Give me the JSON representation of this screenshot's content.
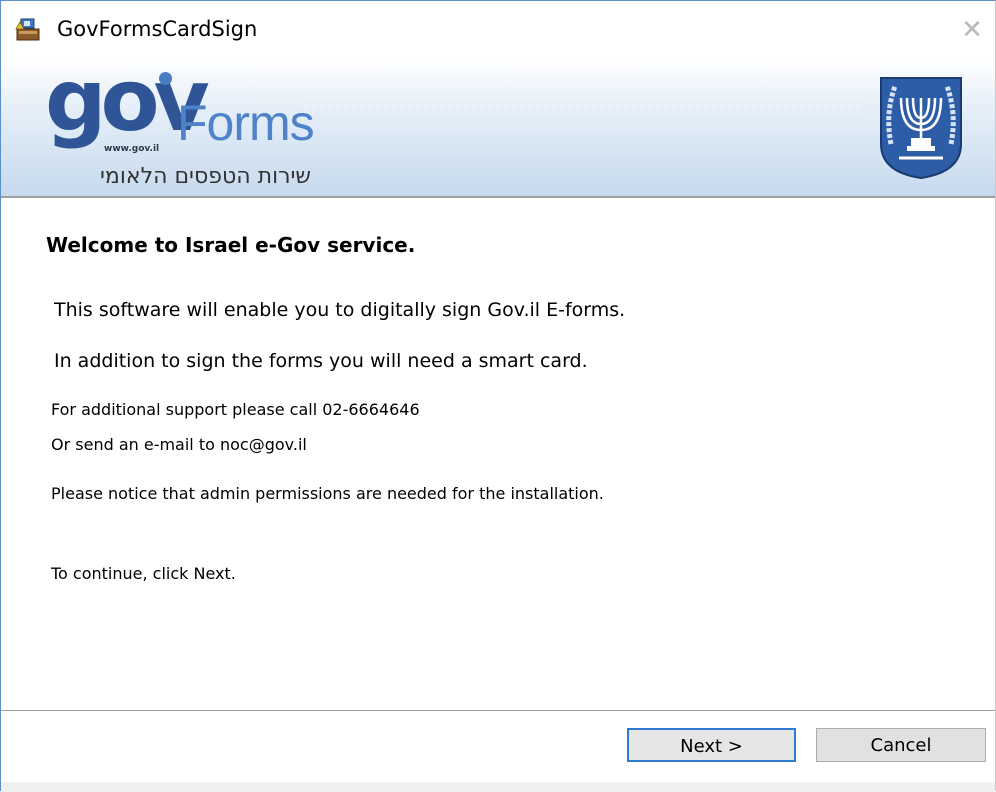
{
  "window": {
    "title": "GovFormsCardSign",
    "close_glyph": "✕"
  },
  "banner": {
    "logo_gov": "gov",
    "logo_forms": "Forms",
    "logo_url": "www.gov.il",
    "logo_hebrew": "שירות הטפסים הלאומי"
  },
  "content": {
    "welcome": "Welcome to Israel e-Gov service.",
    "line1": "This software will enable you to digitally sign Gov.il E-forms.",
    "line2": "In addition to sign the forms you will need a smart card.",
    "support1": "For additional support please call 02-6664646",
    "support2": "Or send an e-mail to noc@gov.il",
    "notice": "Please notice that admin permissions are needed for the installation.",
    "continue": "To continue, click Next."
  },
  "buttons": {
    "next": "Next >",
    "cancel": "Cancel"
  },
  "icons": {
    "app": "installer-icon",
    "emblem": "israel-emblem-icon",
    "close": "close-icon"
  },
  "colors": {
    "accent": "#2f7bd1",
    "logo_dark": "#2f5597",
    "logo_light": "#4f82c9"
  }
}
